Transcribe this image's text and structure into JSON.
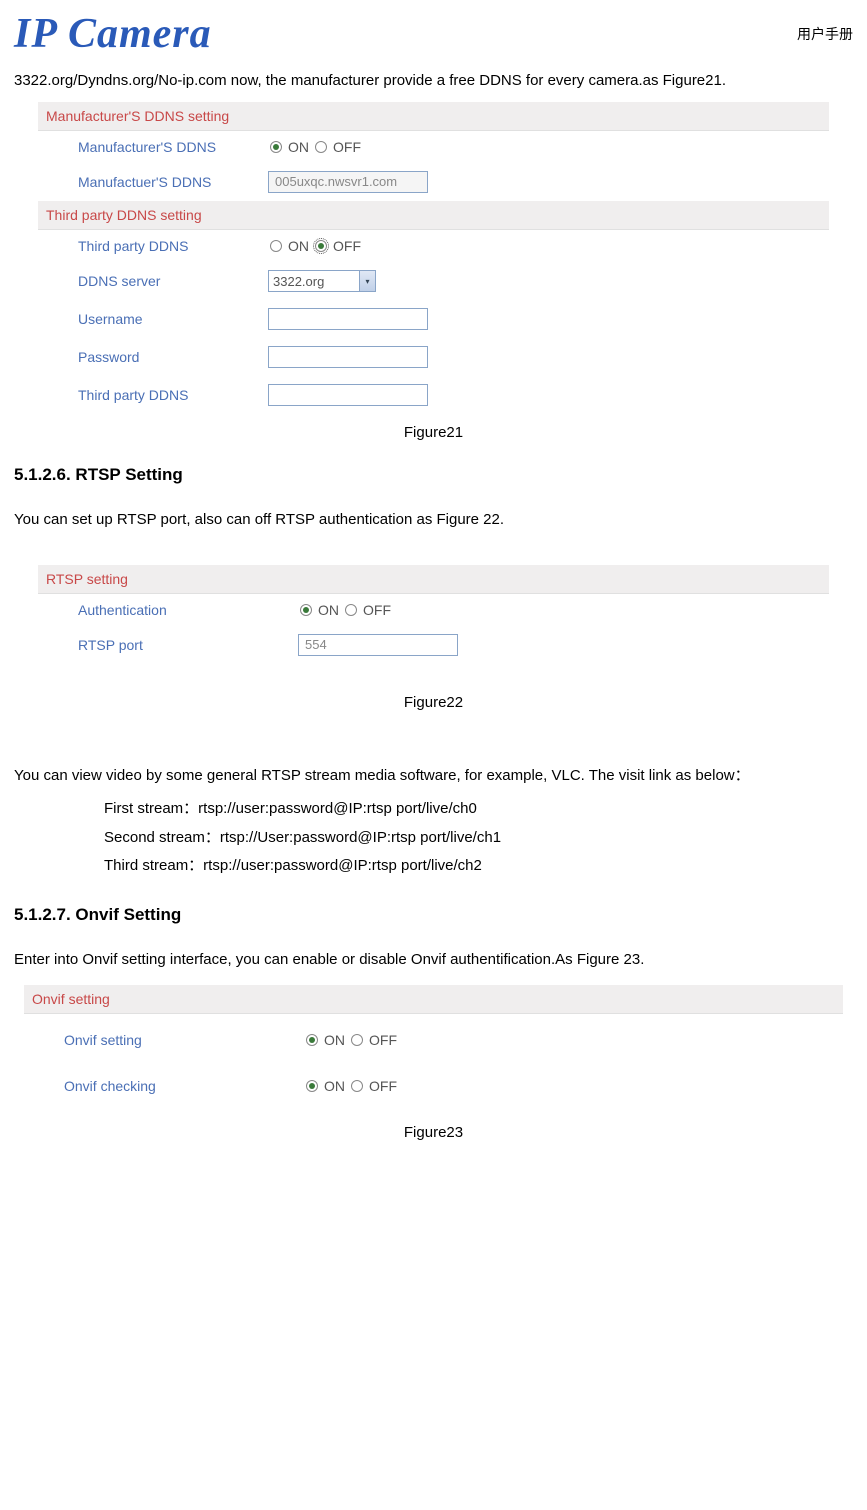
{
  "header": {
    "logo": "IP Camera",
    "cn": "用户手册"
  },
  "intro": "3322.org/Dyndns.org/No-ip.com now, the manufacturer provide a free DDNS for every camera.as Figure21.",
  "fig21": {
    "sec1": "Manufacturer'S DDNS setting",
    "row1": {
      "label": "Manufacturer'S DDNS",
      "on": "ON",
      "off": "OFF"
    },
    "row2": {
      "label": "Manufactuer'S DDNS",
      "value": "005uxqc.nwsvr1.com"
    },
    "sec2": "Third party DDNS setting",
    "row3": {
      "label": "Third party DDNS",
      "on": "ON",
      "off": "OFF"
    },
    "row4": {
      "label": "DDNS server",
      "value": "3322.org"
    },
    "row5": {
      "label": "Username"
    },
    "row6": {
      "label": "Password"
    },
    "row7": {
      "label": "Third party DDNS"
    },
    "caption": "Figure21"
  },
  "section6": {
    "title": "5.1.2.6. RTSP Setting",
    "para1": "You can set up RTSP port, also can off RTSP authentication as Figure 22."
  },
  "fig22": {
    "sec": "RTSP setting",
    "row1": {
      "label": "Authentication",
      "on": "ON",
      "off": "OFF"
    },
    "row2": {
      "label": "RTSP port",
      "value": "554"
    },
    "caption": "Figure22"
  },
  "rtsp_para": "You can view video by some general RTSP stream media software, for example, VLC. The visit link as below：",
  "streams": {
    "s1": "First stream：rtsp://user:password@IP:rtsp port/live/ch0",
    "s2": "Second stream：rtsp://User:password@IP:rtsp port/live/ch1",
    "s3": "Third stream：rtsp://user:password@IP:rtsp port/live/ch2"
  },
  "section7": {
    "title": "5.1.2.7. Onvif   Setting",
    "para1": "Enter into Onvif setting interface, you can enable or disable Onvif authentification.As Figure 23."
  },
  "fig23": {
    "sec": "Onvif setting",
    "row1": {
      "label": "Onvif setting",
      "on": "ON",
      "off": "OFF"
    },
    "row2": {
      "label": "Onvif checking",
      "on": "ON",
      "off": "OFF"
    },
    "caption": "Figure23"
  }
}
